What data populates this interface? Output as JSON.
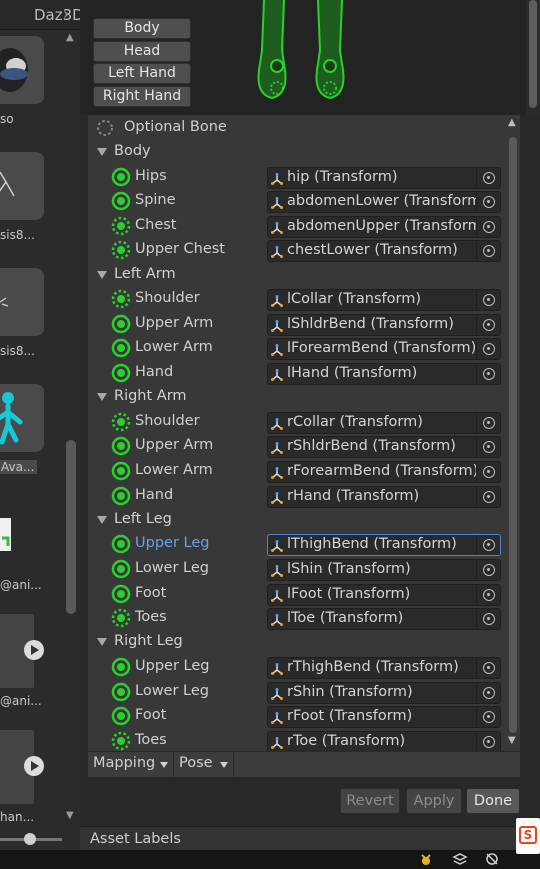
{
  "project_panel": {
    "breadcrumb": "Daz3D",
    "assets": [
      {
        "label": "so"
      },
      {
        "label": "sis8..."
      },
      {
        "label": "sis8..."
      },
      {
        "label": "Ava..."
      },
      {
        "label": "@ani..."
      },
      {
        "label": "@ani..."
      },
      {
        "label": "han..."
      }
    ]
  },
  "preview": {
    "body_buttons": [
      "Body",
      "Head",
      "Left Hand",
      "Right Hand"
    ]
  },
  "mapping": {
    "optional_bone_label": "Optional Bone",
    "groups": [
      {
        "name": "Body",
        "bones": [
          {
            "name": "Hips",
            "value": "hip (Transform)",
            "required": true
          },
          {
            "name": "Spine",
            "value": "abdomenLower (Transform)",
            "required": true
          },
          {
            "name": "Chest",
            "value": "abdomenUpper (Transform)",
            "required": false
          },
          {
            "name": "Upper Chest",
            "value": "chestLower (Transform)",
            "required": false
          }
        ]
      },
      {
        "name": "Left Arm",
        "bones": [
          {
            "name": "Shoulder",
            "value": "lCollar (Transform)",
            "required": false
          },
          {
            "name": "Upper Arm",
            "value": "lShldrBend (Transform)",
            "required": true
          },
          {
            "name": "Lower Arm",
            "value": "lForearmBend (Transform)",
            "required": true
          },
          {
            "name": "Hand",
            "value": "lHand (Transform)",
            "required": true
          }
        ]
      },
      {
        "name": "Right Arm",
        "bones": [
          {
            "name": "Shoulder",
            "value": "rCollar (Transform)",
            "required": false
          },
          {
            "name": "Upper Arm",
            "value": "rShldrBend (Transform)",
            "required": true
          },
          {
            "name": "Lower Arm",
            "value": "rForearmBend (Transform)",
            "required": true
          },
          {
            "name": "Hand",
            "value": "rHand (Transform)",
            "required": true
          }
        ]
      },
      {
        "name": "Left Leg",
        "bones": [
          {
            "name": "Upper Leg",
            "value": "lThighBend (Transform)",
            "required": true,
            "selected": true
          },
          {
            "name": "Lower Leg",
            "value": "lShin (Transform)",
            "required": true
          },
          {
            "name": "Foot",
            "value": "lFoot (Transform)",
            "required": true
          },
          {
            "name": "Toes",
            "value": "lToe (Transform)",
            "required": false
          }
        ]
      },
      {
        "name": "Right Leg",
        "bones": [
          {
            "name": "Upper Leg",
            "value": "rThighBend (Transform)",
            "required": true
          },
          {
            "name": "Lower Leg",
            "value": "rShin (Transform)",
            "required": true
          },
          {
            "name": "Foot",
            "value": "rFoot (Transform)",
            "required": true
          },
          {
            "name": "Toes",
            "value": "rToe (Transform)",
            "required": false
          }
        ]
      }
    ],
    "mapping_dropdown": "Mapping",
    "pose_dropdown": "Pose"
  },
  "footer": {
    "revert": "Revert",
    "apply": "Apply",
    "done": "Done"
  },
  "asset_labels": "Asset Labels",
  "colors": {
    "bone_green": "#27d22b",
    "selected_blue": "#6aa0ea",
    "accent_avatar": "#16c8d8"
  }
}
